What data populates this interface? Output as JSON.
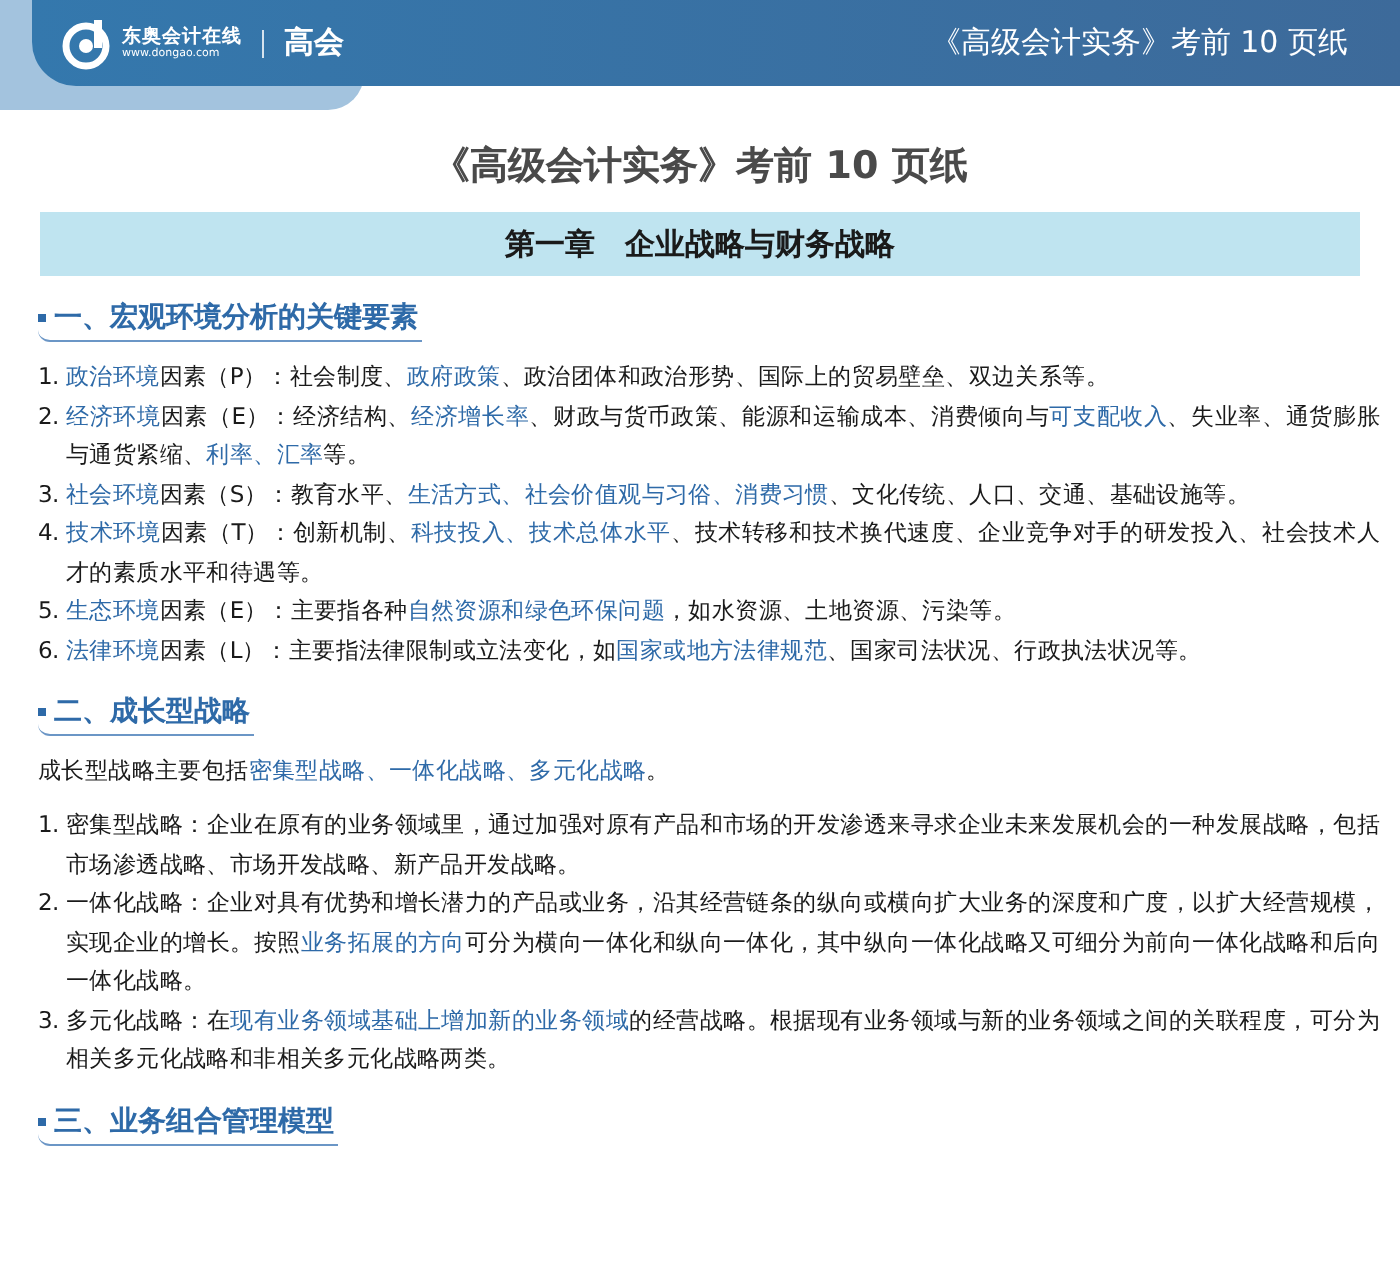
{
  "header": {
    "logo_name": "东奥会计在线",
    "logo_url": "www.dongao.com",
    "category": "高会",
    "doc_title": "《高级会计实务》考前 10 页纸"
  },
  "title": "《高级会计实务》考前 10 页纸",
  "chapter": "第一章　企业战略与财务战略",
  "sections": [
    {
      "heading": "一、宏观环境分析的关键要素",
      "items": [
        {
          "number": "1.",
          "parts": [
            {
              "text": "政治环境",
              "highlight": true
            },
            {
              "text": "因素（P）：社会制度、",
              "highlight": false
            },
            {
              "text": "政府政策",
              "highlight": true
            },
            {
              "text": "、政治团体和政治形势、国际上的贸易壁垒、双边关系等。",
              "highlight": false
            }
          ]
        },
        {
          "number": "2.",
          "parts": [
            {
              "text": "经济环境",
              "highlight": true
            },
            {
              "text": "因素（E）：经济结构、",
              "highlight": false
            },
            {
              "text": "经济增长率",
              "highlight": true
            },
            {
              "text": "、财政与货币政策、能源和运输成本、消费倾向与",
              "highlight": false
            },
            {
              "text": "可支配收入",
              "highlight": true
            },
            {
              "text": "、失业率、通货膨胀与通货紧缩、",
              "highlight": false
            },
            {
              "text": "利率、汇率",
              "highlight": true
            },
            {
              "text": "等。",
              "highlight": false
            }
          ]
        },
        {
          "number": "3.",
          "parts": [
            {
              "text": "社会环境",
              "highlight": true
            },
            {
              "text": "因素（S）：教育水平、",
              "highlight": false
            },
            {
              "text": "生活方式、社会价值观与习俗、消费习惯",
              "highlight": true
            },
            {
              "text": "、文化传统、人口、交通、基础设施等。",
              "highlight": false
            }
          ]
        },
        {
          "number": "4.",
          "parts": [
            {
              "text": "技术环境",
              "highlight": true
            },
            {
              "text": "因素（T）：创新机制、",
              "highlight": false
            },
            {
              "text": "科技投入、技术总体水平",
              "highlight": true
            },
            {
              "text": "、技术转移和技术换代速度、企业竞争对手的研发投入、社会技术人才的素质水平和待遇等。",
              "highlight": false
            }
          ]
        },
        {
          "number": "5.",
          "parts": [
            {
              "text": "生态环境",
              "highlight": true
            },
            {
              "text": "因素（E）：主要指各种",
              "highlight": false
            },
            {
              "text": "自然资源和绿色环保问题",
              "highlight": true
            },
            {
              "text": "，如水资源、土地资源、污染等。",
              "highlight": false
            }
          ]
        },
        {
          "number": "6.",
          "parts": [
            {
              "text": "法律环境",
              "highlight": true
            },
            {
              "text": "因素（L）：主要指法律限制或立法变化，如",
              "highlight": false
            },
            {
              "text": "国家或地方法律规范",
              "highlight": true
            },
            {
              "text": "、国家司法状况、行政执法状况等。",
              "highlight": false
            }
          ]
        }
      ]
    },
    {
      "heading": "二、成长型战略",
      "intro": [
        {
          "text": "成长型战略主要包括",
          "highlight": false
        },
        {
          "text": "密集型战略、一体化战略、多元化战略",
          "highlight": true
        },
        {
          "text": "。",
          "highlight": false
        }
      ],
      "items": [
        {
          "number": "1.",
          "parts": [
            {
              "text": "密集型战略：企业在原有的业务领域里，通过加强对原有产品和市场的开发渗透来寻求企业未来发展机会的一种发展战略，包括市场渗透战略、市场开发战略、新产品开发战略。",
              "highlight": false
            }
          ]
        },
        {
          "number": "2.",
          "parts": [
            {
              "text": "一体化战略：企业对具有优势和增长潜力的产品或业务，沿其经营链条的纵向或横向扩大业务的深度和广度，以扩大经营规模，实现企业的增长。按照",
              "highlight": false
            },
            {
              "text": "业务拓展的方向",
              "highlight": true
            },
            {
              "text": "可分为横向一体化和纵向一体化，其中纵向一体化战略又可细分为前向一体化战略和后向一体化战略。",
              "highlight": false
            }
          ]
        },
        {
          "number": "3.",
          "parts": [
            {
              "text": "多元化战略：在",
              "highlight": false
            },
            {
              "text": "现有业务领域基础上增加新的业务领域",
              "highlight": true
            },
            {
              "text": "的经营战略。根据现有业务领域与新的业务领域之间的关联程度，可分为相关多元化战略和非相关多元化战略两类。",
              "highlight": false
            }
          ]
        }
      ]
    },
    {
      "heading": "三、业务组合管理模型"
    }
  ]
}
